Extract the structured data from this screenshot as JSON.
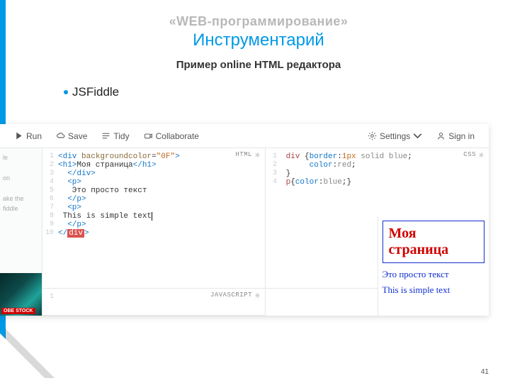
{
  "slide": {
    "eyebrow": "«WEB-программирование»",
    "title": "Инструментарий",
    "subtitle": "Пример  online HTML редактора",
    "bullet": "JSFiddle",
    "page_number": "41"
  },
  "toolbar": {
    "run": "Run",
    "save": "Save",
    "tidy": "Tidy",
    "collaborate": "Collaborate",
    "settings": "Settings",
    "signin": "Sign in"
  },
  "sidebar": {
    "lines": [
      "le",
      "on",
      "ake the fiddle"
    ],
    "stock_label": "OBE STOCK"
  },
  "pane_labels": {
    "html": "HTML",
    "css": "CSS",
    "js": "JAVASCRIPT"
  },
  "html_code": [
    {
      "n": "1",
      "html": "<span class='tag'>&lt;div</span> <span class='attr'>backgroundcolor</span>=<span class='str'>\"0F\"</span><span class='tag'>&gt;</span>"
    },
    {
      "n": "2",
      "html": "<span class='tag'>&lt;h1&gt;</span>Моя страница<span class='tag'>&lt;/h1&gt;</span>"
    },
    {
      "n": "3",
      "html": "  <span class='tag'>&lt;/div&gt;</span>"
    },
    {
      "n": "4",
      "html": "  <span class='tag'>&lt;p&gt;</span>"
    },
    {
      "n": "5",
      "html": "   Это просто текст"
    },
    {
      "n": "6",
      "html": "  <span class='tag'>&lt;/p&gt;</span>"
    },
    {
      "n": "7",
      "html": "  <span class='tag'>&lt;p&gt;</span>"
    },
    {
      "n": "8",
      "html": " This is simple text<span style='border-left:1px solid #000'></span>"
    },
    {
      "n": "9",
      "html": "  <span class='tag'>&lt;/p&gt;</span>"
    },
    {
      "n": "10",
      "html": "<span class='tag'>&lt;/</span><span class='err'>div</span><span class='tag'>&gt;</span>"
    }
  ],
  "css_code": [
    {
      "n": "1",
      "html": " <span class='css-sel'>div</span> {<span class='css-prop'>border</span>:<span class='css-num'>1px</span> <span class='css-val'>solid blue</span>;"
    },
    {
      "n": "2",
      "html": "      <span class='css-prop'>color</span>:<span class='css-val'>red</span>;"
    },
    {
      "n": "3",
      "html": " }"
    },
    {
      "n": "4",
      "html": " <span class='css-sel'>p</span>{<span class='css-prop'>color</span>:<span class='css-val'>blue</span>;}"
    }
  ],
  "js_code": [
    {
      "n": "1",
      "html": ""
    }
  ],
  "preview": {
    "h1": "Моя страница",
    "p1": "Это просто текст",
    "p2": "This is simple text"
  }
}
